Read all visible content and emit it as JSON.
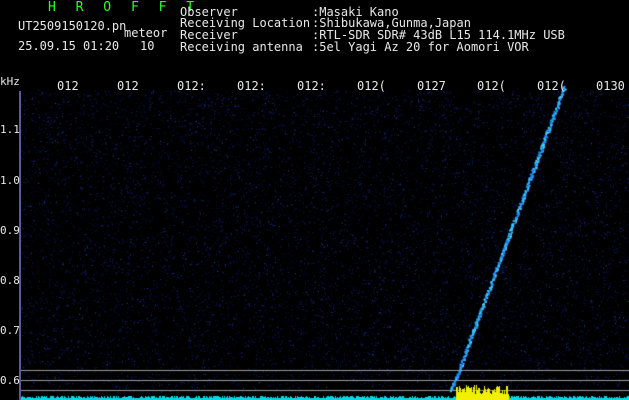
{
  "header": {
    "app_name": "H R O F F T",
    "file_name": "UT2509150120.pn",
    "meteor_label": "meteor",
    "datetime": "25.09.15 01:20",
    "count": "10",
    "fields": [
      {
        "label": "Observer",
        "value": ":Masaki Kano"
      },
      {
        "label": "Receiving Location",
        "value": ":Shibukawa,Gunma,Japan"
      },
      {
        "label": "Receiver",
        "value": ":RTL-SDR SDR# 43dB L15 114.1MHz USB"
      },
      {
        "label": "Receiving antenna",
        "value": ":5el Yagi Az 20 for Aomori VOR"
      }
    ]
  },
  "axis": {
    "y_unit": "kHz",
    "y_ticks": [
      "1.1",
      "1.0",
      "0.9",
      "0.8",
      "0.7",
      "0.6"
    ],
    "x_ticks": [
      "012",
      "012",
      "012:",
      "012:",
      "012:",
      "012(",
      "0127",
      "012(",
      "012(",
      "0130"
    ]
  },
  "colors": {
    "background": "#000000",
    "noise": "#0a1a7a",
    "signal": "#38c8ff",
    "baseline": "#00d8e8",
    "burst": "#f0f000",
    "guide_line": "#9a9a9a",
    "title": "#2aff2a",
    "text": "#e8e8e8"
  }
}
